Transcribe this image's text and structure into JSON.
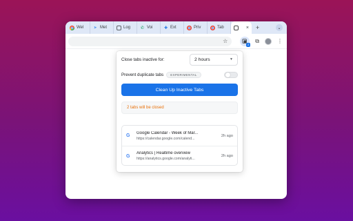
{
  "browser": {
    "tabs": [
      {
        "label": "Wel",
        "icon": "chrome-icon",
        "color": "#ea4335"
      },
      {
        "label": "Met",
        "icon": "meta-icon",
        "color": "#1877f2"
      },
      {
        "label": "Log",
        "icon": "doc-icon",
        "color": "#5f6368"
      },
      {
        "label": "Voi",
        "icon": "phone-icon",
        "color": "#0f9d58"
      },
      {
        "label": "Ext",
        "icon": "puzzle-icon",
        "color": "#1a73e8"
      },
      {
        "label": "Priv",
        "icon": "chrome-icon",
        "color": "#ea4335"
      },
      {
        "label": "Tab",
        "icon": "chrome-icon",
        "color": "#ea4335"
      }
    ],
    "active_tab_close": "×",
    "new_tab": "+",
    "tab_menu": "⌄",
    "toolbar": {
      "bookmark_star": "☆",
      "extensions_icon": "⧉",
      "more_menu": "⋮",
      "ext_badge": "2"
    }
  },
  "popup": {
    "close_label": "Close tabs inactive for:",
    "close_value": "2 hours",
    "dup_label": "Prevent duplicate tabs",
    "dup_badge": "EXPERIMENTAL",
    "dup_enabled": false,
    "cta_label": "Clean Up Inactive Tabs",
    "status_text": "2 tabs will be closed",
    "accent": "#1a73e8",
    "status_color": "#e8710a",
    "items": [
      {
        "title": "Google Calendar - Week of Mar...",
        "url": "https://calendar.google.com/calend...",
        "time": "2h ago",
        "icon": "google-icon"
      },
      {
        "title": "Analytics | Realtime overview",
        "url": "https://analytics.google.com/analyti...",
        "time": "2h ago",
        "icon": "google-icon"
      }
    ]
  }
}
